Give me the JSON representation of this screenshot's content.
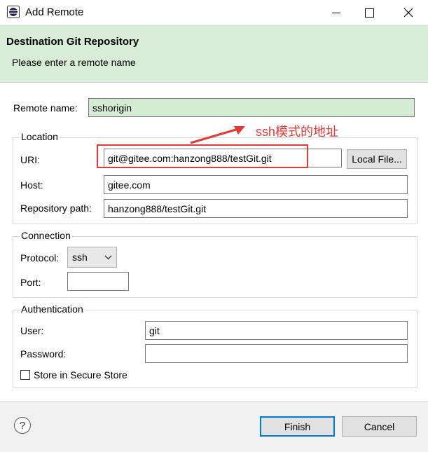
{
  "window": {
    "title": "Add Remote",
    "controls": {
      "minimize": "—",
      "maximize": "☐",
      "close": "✕"
    }
  },
  "banner": {
    "title": "Destination Git Repository",
    "message": "Please enter a remote name"
  },
  "remote": {
    "label": "Remote name:",
    "value": "sshorigin"
  },
  "location": {
    "title": "Location",
    "uri_label": "URI:",
    "uri_value": "git@gitee.com:hanzong888/testGit.git",
    "local_file_button": "Local File...",
    "host_label": "Host:",
    "host_value": "gitee.com",
    "path_label": "Repository path:",
    "path_value": "hanzong888/testGit.git"
  },
  "connection": {
    "title": "Connection",
    "protocol_label": "Protocol:",
    "protocol_value": "ssh",
    "port_label": "Port:",
    "port_value": ""
  },
  "authentication": {
    "title": "Authentication",
    "user_label": "User:",
    "user_value": "git",
    "password_label": "Password:",
    "password_value": "",
    "store_label": "Store in Secure Store"
  },
  "annotation": {
    "text": "ssh模式的地址"
  },
  "footer": {
    "help": "?",
    "finish": "Finish",
    "cancel": "Cancel"
  },
  "colors": {
    "banner_bg": "#d8ecd8",
    "remote_field_bg": "#d4ecd4",
    "annotation": "#e53935",
    "primary_border": "#0078d7"
  }
}
